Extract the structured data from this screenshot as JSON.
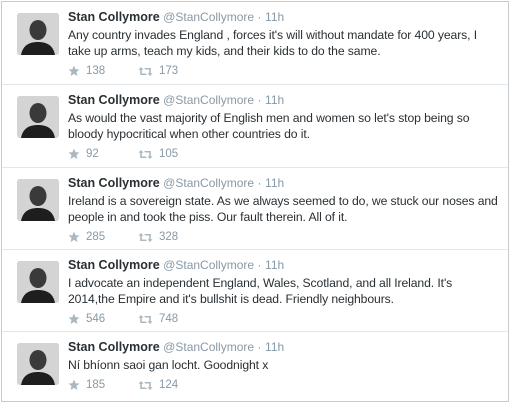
{
  "tweets": [
    {
      "name": "Stan Collymore",
      "handle": "@StanCollymore",
      "dot": "·",
      "time": "11h",
      "text": "Any country invades England , forces it's will without mandate for 400 years, I take up arms, teach my kids, and their kids to do the same.",
      "favorites": "138",
      "retweets": "173"
    },
    {
      "name": "Stan Collymore",
      "handle": "@StanCollymore",
      "dot": "·",
      "time": "11h",
      "text": "As would the vast majority of English men and women  so let's stop being so bloody  hypocritical when other countries do it.",
      "favorites": "92",
      "retweets": "105"
    },
    {
      "name": "Stan Collymore",
      "handle": "@StanCollymore",
      "dot": "·",
      "time": "11h",
      "text": "Ireland is a sovereign state. As we always seemed to do, we stuck our noses and people in and took the piss. Our fault therein. All of it.",
      "favorites": "285",
      "retweets": "328"
    },
    {
      "name": "Stan Collymore",
      "handle": "@StanCollymore",
      "dot": "·",
      "time": "11h",
      "text": "I advocate an independent England, Wales, Scotland, and all Ireland. It's 2014,the Empire and it's bullshit is dead. Friendly neighbours.",
      "favorites": "546",
      "retweets": "748"
    },
    {
      "name": "Stan Collymore",
      "handle": "@StanCollymore",
      "dot": "·",
      "time": "11h",
      "text": "Ní bhíonn saoi gan locht. Goodnight x",
      "favorites": "185",
      "retweets": "124"
    }
  ],
  "colors": {
    "name": "#292f33",
    "meta": "#8899a6",
    "divider": "#e1e8ed"
  }
}
